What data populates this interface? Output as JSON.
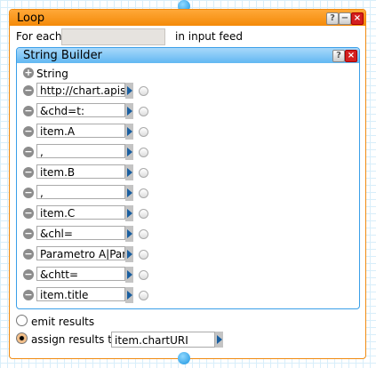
{
  "loop": {
    "title": "Loop",
    "help": "?",
    "minimize": "−",
    "close": "×",
    "for_each_label": "For each",
    "for_each_value": "",
    "in_input_feed": "in input feed",
    "string_builder": {
      "title": "String Builder",
      "help": "?",
      "close": "×",
      "add_label": "String",
      "items": [
        "http://chart.apis.google.com",
        "&chd=t:",
        "item.A",
        ",",
        "item.B",
        ",",
        "item.C",
        "&chl=",
        "Parametro A|Parametro",
        "&chtt=",
        "item.title"
      ]
    },
    "emit_label": "emit results",
    "assign_label": "assign results to",
    "assign_value": "item.chartURI",
    "selected_option": "assign"
  }
}
